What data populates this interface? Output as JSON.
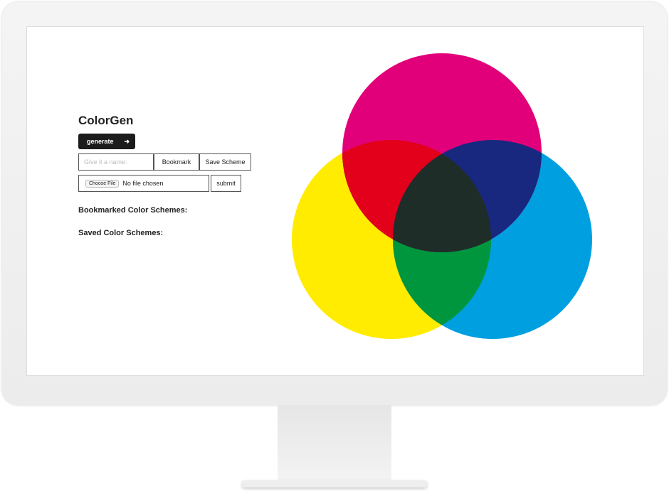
{
  "app": {
    "title": "ColorGen"
  },
  "controls": {
    "generate_label": "generate",
    "generate_icon": "arrow-right-icon",
    "name_placeholder": "Give it a name:",
    "bookmark_label": "Bookmark",
    "save_label": "Save Scheme",
    "choose_file_label": "Choose File",
    "file_status": "No file chosen",
    "submit_label": "submit"
  },
  "sections": {
    "bookmarked": "Bookmarked Color Schemes:",
    "saved": "Saved Color Schemes:"
  },
  "colors": {
    "magenta": "#e2007a",
    "yellow": "#ffec00",
    "cyan": "#009fe0",
    "red": "#e2001a",
    "navy": "#18287f",
    "green": "#00963e",
    "dark": "#1f2d29"
  }
}
